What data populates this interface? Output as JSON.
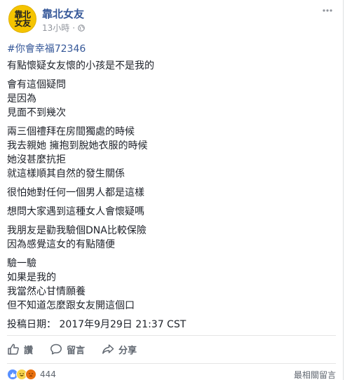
{
  "page": {
    "avatar_text": [
      "靠北",
      "女友"
    ],
    "name": "靠北女友",
    "time": "13小時"
  },
  "post": {
    "hashtag": "#你會幸福72346",
    "paragraphs": [
      [
        "有點懷疑女友懷的小孩是不是我的"
      ],
      [
        "會有這個疑問",
        "是因為",
        "見面不到幾次"
      ],
      [
        "兩三個禮拜在房間獨處的時候",
        "我去親她 擁抱到脫她衣服的時候",
        "她沒甚麼抗拒",
        "就這樣順其自然的發生關係"
      ],
      [
        "很怕她對任何一個男人都是這樣"
      ],
      [
        "想問大家遇到這種女人會懷疑嗎"
      ],
      [
        "我朋友是勸我驗個DNA比較保險",
        "因為感覺這女的有點隨便"
      ],
      [
        "驗一驗",
        "如果是我的",
        "我當然心甘情願養",
        "但不知道怎麼跟女友開這個口"
      ],
      [
        "投稿日期： 2017年9月29日 21:37 CST"
      ]
    ]
  },
  "actions": {
    "like": "讚",
    "comment": "留言",
    "share": "分享"
  },
  "footer": {
    "reaction_count": "444",
    "sort_label": "最相關留言"
  },
  "icons": {
    "globe": "globe-icon",
    "more": "more-options-icon",
    "like": "thumbs-up-icon",
    "comment": "comment-bubble-icon",
    "share": "share-arrow-icon"
  },
  "colors": {
    "link": "#365899",
    "text": "#1d2129",
    "muted": "#90949c",
    "avatar_bg": "#f5c400",
    "like_blue": "#5890ff",
    "haha_yellow": "#f7d44d",
    "angry_orange": "#e9710f"
  }
}
